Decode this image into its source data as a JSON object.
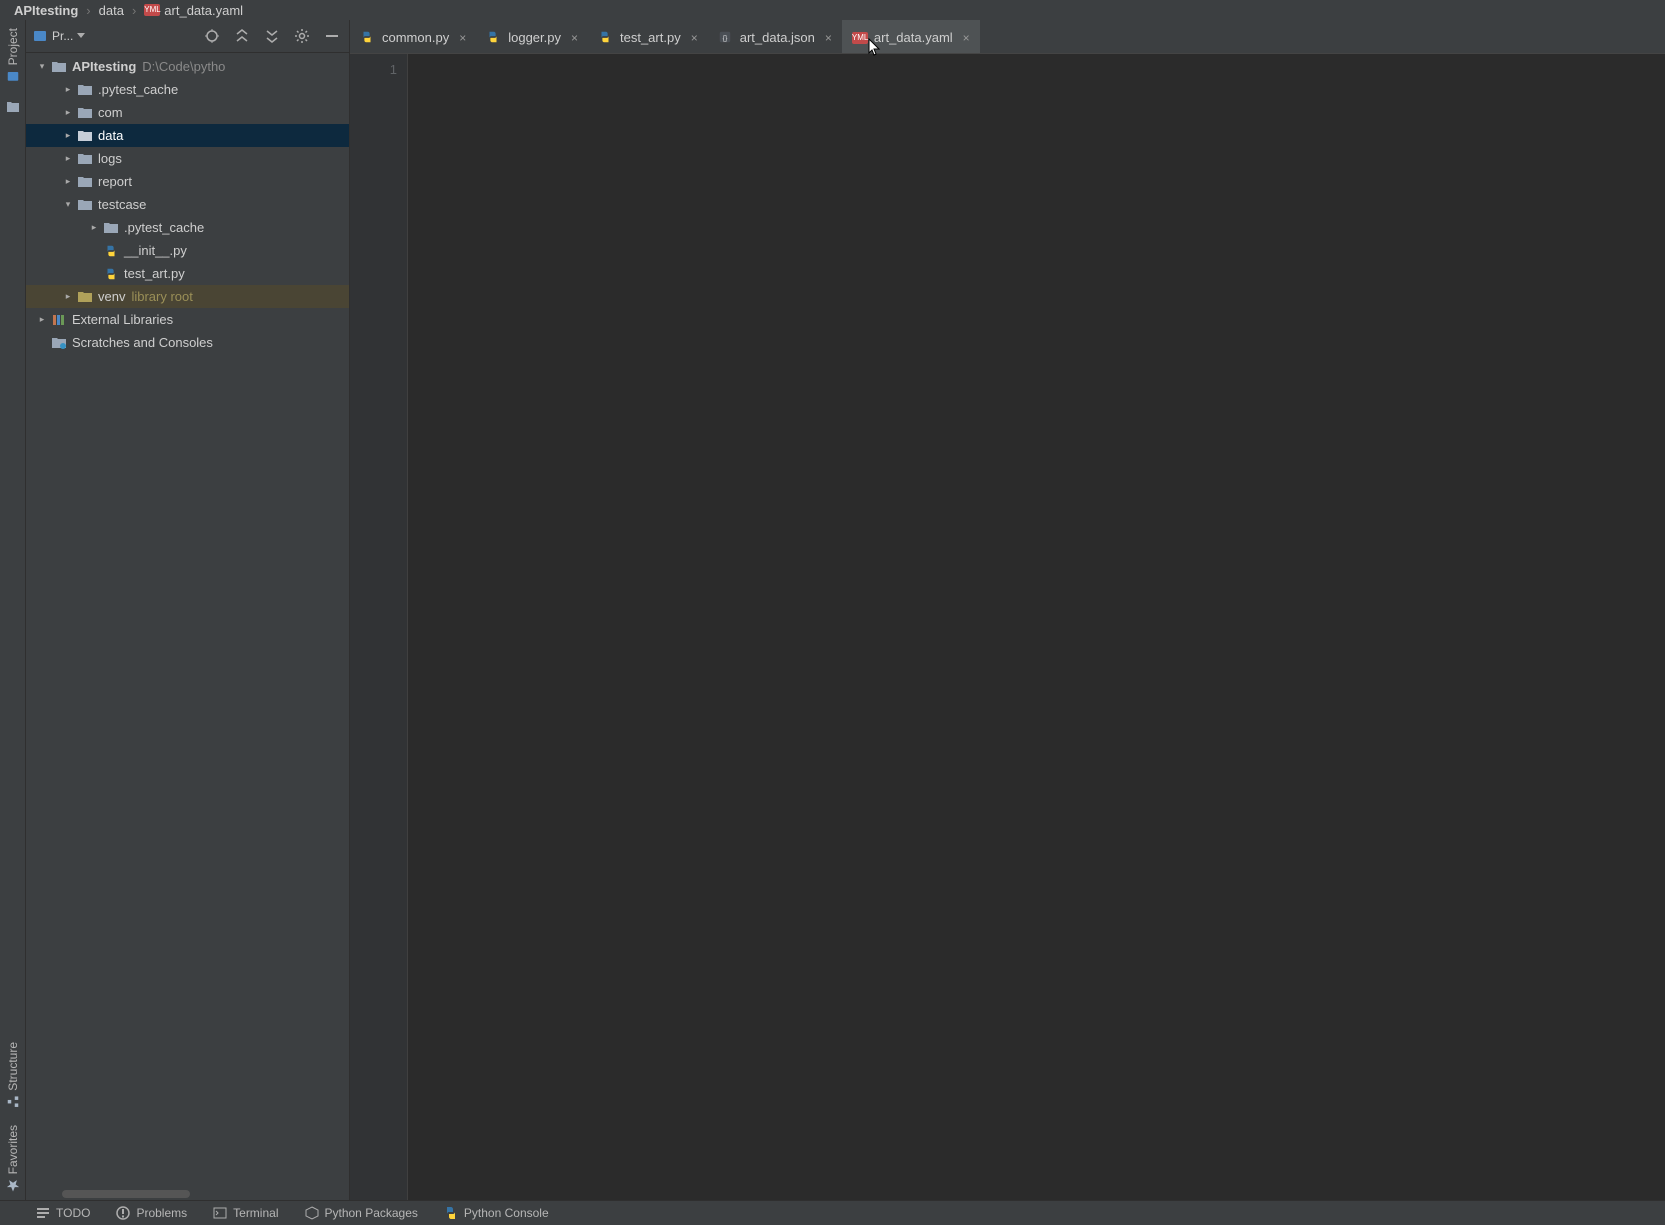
{
  "breadcrumb": {
    "root": "APItesting",
    "mid": "data",
    "file": "art_data.yaml"
  },
  "proj_header": {
    "label": "Pr..."
  },
  "tree": {
    "root_name": "APItesting",
    "root_path": "D:\\Code\\pytho",
    "items": [
      {
        "label": ".pytest_cache"
      },
      {
        "label": "com"
      },
      {
        "label": "data"
      },
      {
        "label": "logs"
      },
      {
        "label": "report"
      },
      {
        "label": "testcase"
      },
      {
        "label": ".pytest_cache"
      },
      {
        "label": "__init__.py"
      },
      {
        "label": "test_art.py"
      },
      {
        "label": "venv",
        "extra": "library root"
      },
      {
        "label": "External Libraries"
      },
      {
        "label": "Scratches and Consoles"
      }
    ]
  },
  "tabs": [
    {
      "label": "common.py",
      "type": "py"
    },
    {
      "label": "logger.py",
      "type": "py"
    },
    {
      "label": "test_art.py",
      "type": "py"
    },
    {
      "label": "art_data.json",
      "type": "json"
    },
    {
      "label": "art_data.yaml",
      "type": "yml"
    }
  ],
  "active_tab_index": 4,
  "editor": {
    "line_number": "1"
  },
  "left_tools": {
    "project": "Project",
    "structure": "Structure",
    "favorites": "Favorites"
  },
  "bottom": {
    "todo": "TODO",
    "problems": "Problems",
    "terminal": "Terminal",
    "pypkg": "Python Packages",
    "pycon": "Python Console"
  }
}
